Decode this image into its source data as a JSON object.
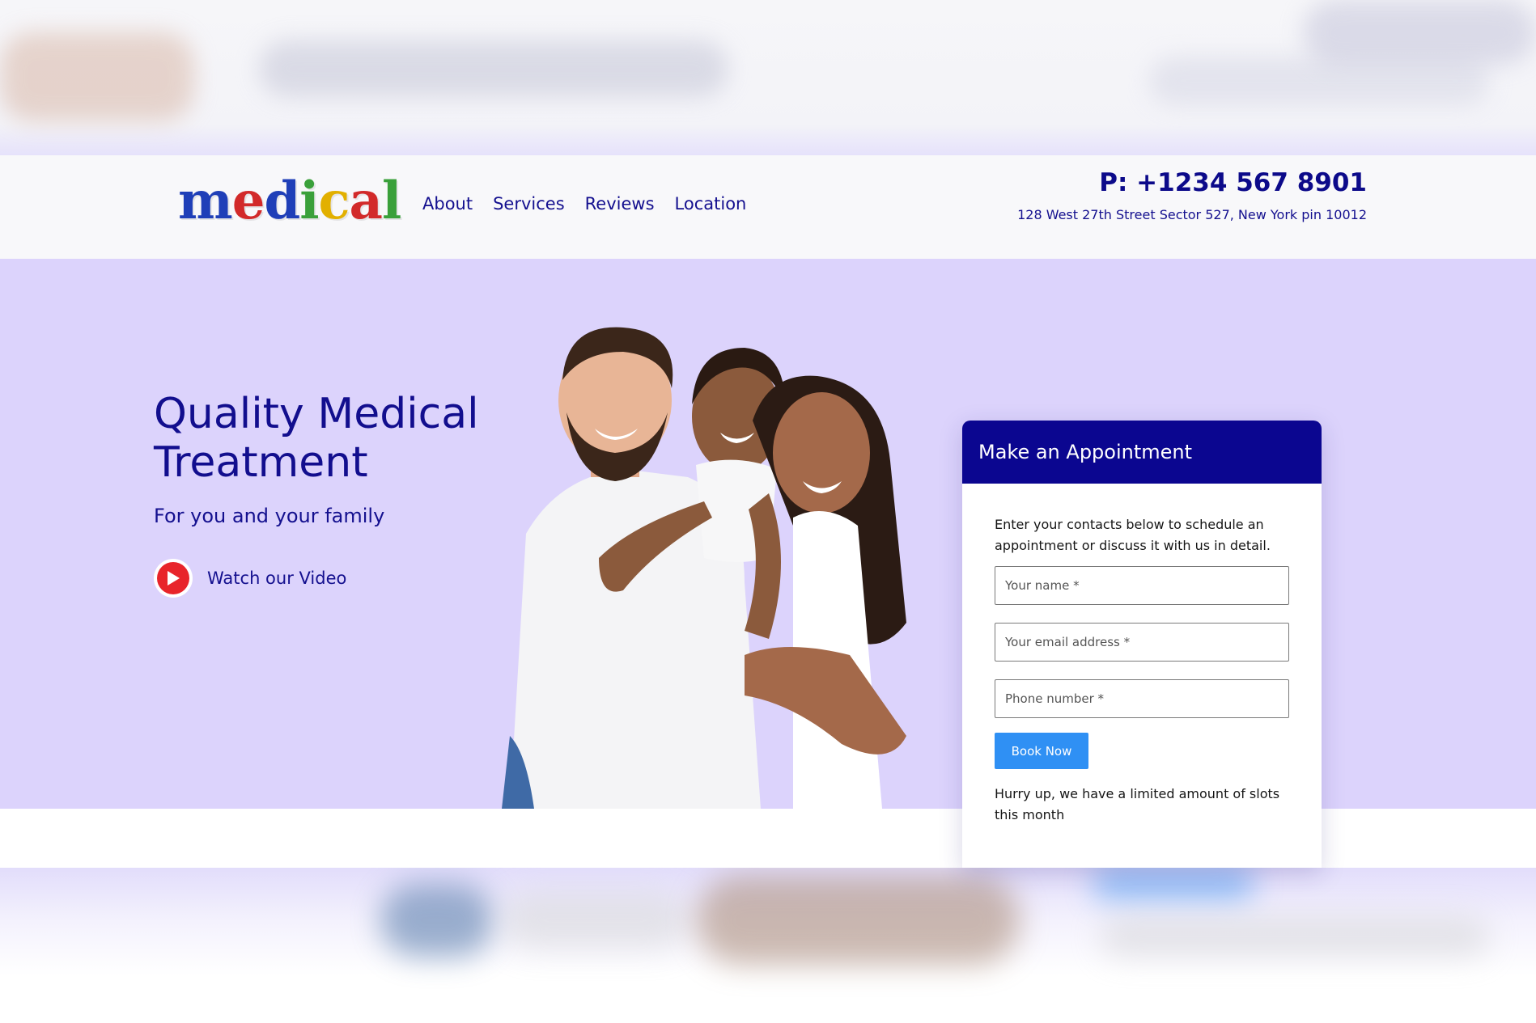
{
  "header": {
    "logo_letters": [
      {
        "ch": "m",
        "color": "#1f3fb8"
      },
      {
        "ch": "e",
        "color": "#d22a2a"
      },
      {
        "ch": "d",
        "color": "#1f3fb8"
      },
      {
        "ch": "i",
        "color": "#3aa03a"
      },
      {
        "ch": "c",
        "color": "#e2b000"
      },
      {
        "ch": "a",
        "color": "#d22a2a"
      },
      {
        "ch": "l",
        "color": "#3aa03a"
      }
    ],
    "nav": [
      "About",
      "Services",
      "Reviews",
      "Location"
    ],
    "phone": "P: +1234 567 8901",
    "address": "128 West 27th Street Sector 527, New York pin 10012"
  },
  "hero": {
    "title": "Quality Medical Treatment",
    "subtitle": "For you and your family",
    "video_label": "Watch our Video",
    "video_icon": "play-icon"
  },
  "appointment": {
    "title": "Make an Appointment",
    "intro": "Enter your contacts below to schedule an appointment or discuss it with us in detail.",
    "fields": {
      "name_placeholder": "Your name *",
      "email_placeholder": "Your email address *",
      "phone_placeholder": "Phone number *"
    },
    "button": "Book Now",
    "note": "Hurry up, we have a limited amount of slots this month"
  },
  "colors": {
    "brand_navy": "#0b0690",
    "hero_bg": "#dcd3fc",
    "button_blue": "#2f90f4",
    "play_red": "#e8242a"
  }
}
